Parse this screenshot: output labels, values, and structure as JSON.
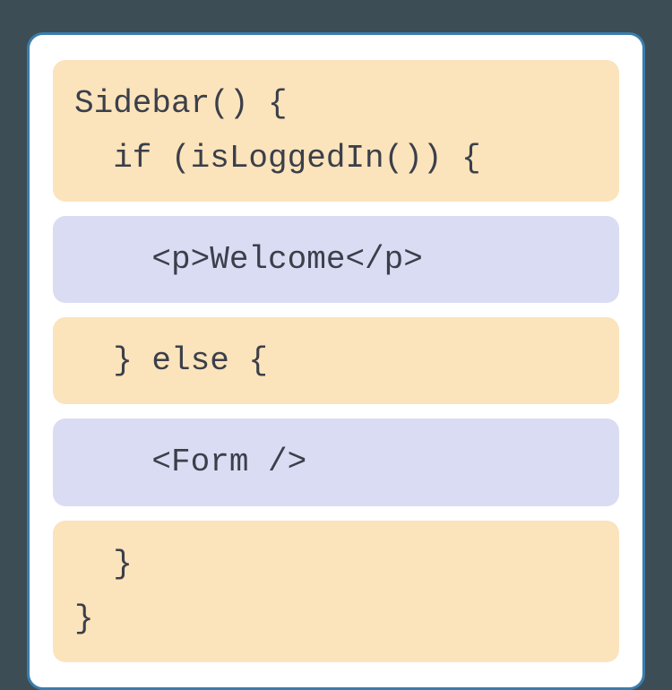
{
  "blocks": {
    "b1_line1": "Sidebar() {",
    "b1_line2": "  if (isLoggedIn()) {",
    "b2": "    <p>Welcome</p>",
    "b3": "  } else {",
    "b4": "    <Form />",
    "b5_line1": "  }",
    "b5_line2": "}"
  }
}
